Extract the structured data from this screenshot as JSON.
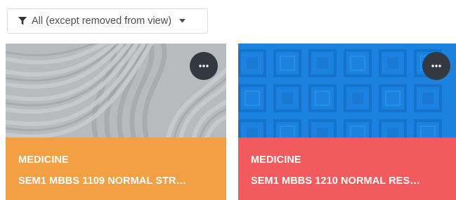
{
  "filter": {
    "label": "All (except removed from view)",
    "icon": "funnel-icon",
    "caret_icon": "caret-down-icon"
  },
  "cards": [
    {
      "subject": "MEDICINE",
      "title": "SEM1 MBBS 1109 NORMAL STR…",
      "footer_color": "#f39f43",
      "image_style": "grey-wave-pattern",
      "more_icon": "more-horizontal-icon"
    },
    {
      "subject": "MEDICINE",
      "title": "SEM1 MBBS 1210 NORMAL RES…",
      "footer_color": "#f25b5e",
      "image_style": "blue-square-pattern",
      "more_icon": "more-horizontal-icon"
    }
  ]
}
